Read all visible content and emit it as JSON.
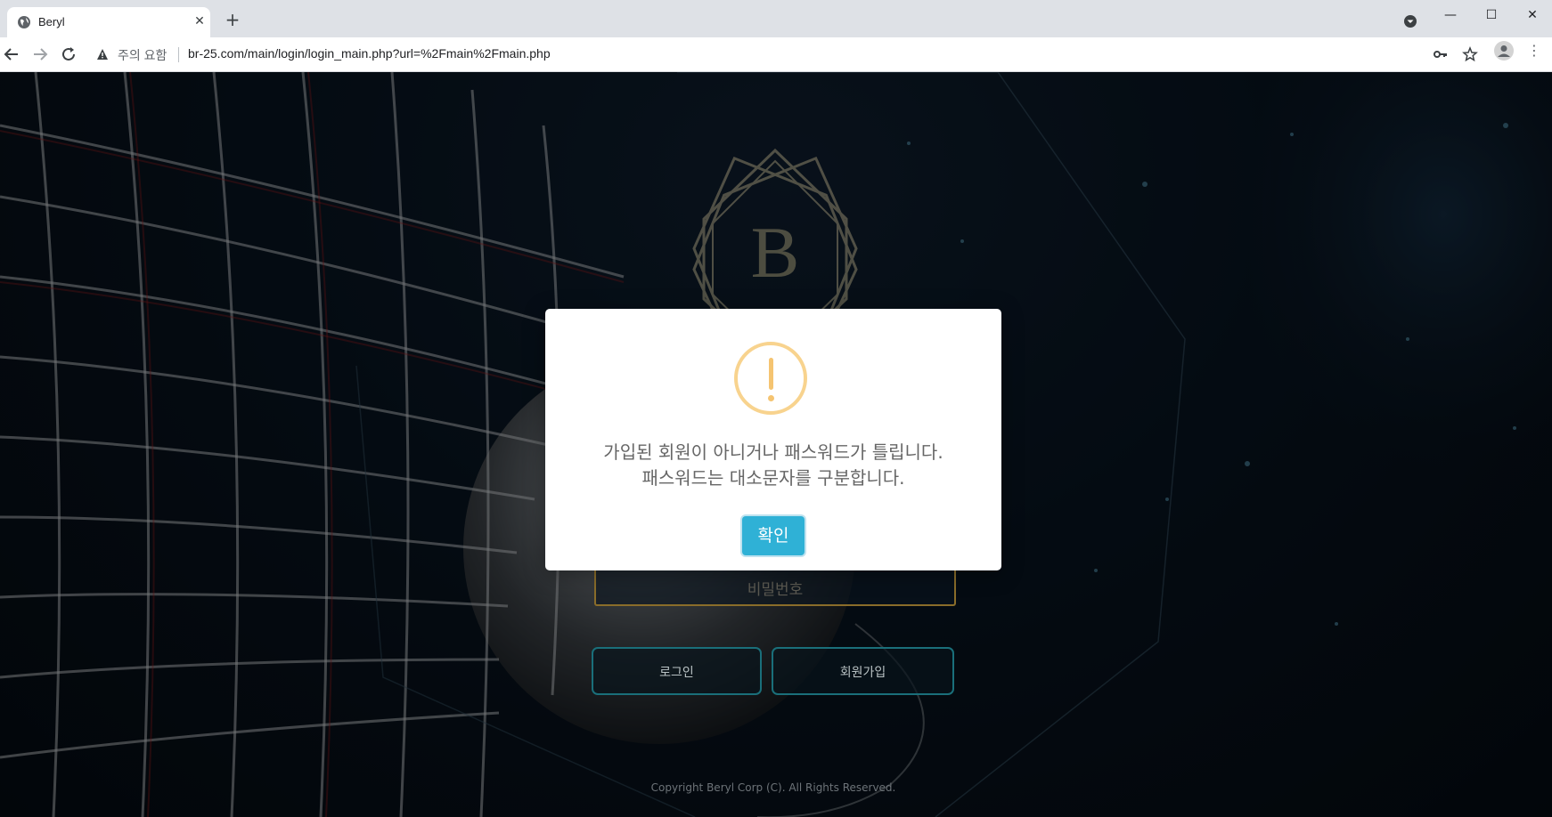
{
  "browser": {
    "tab_title": "Beryl",
    "tab_close": "✕",
    "new_tab": "+",
    "security_label": "주의 요함",
    "url": "br-25.com/main/login/login_main.php?url=%2Fmain%2Fmain.php",
    "window": {
      "minimize": "—",
      "maximize": "☐",
      "close": "✕"
    },
    "menu": "⋮"
  },
  "login": {
    "logo_letter": "B",
    "password_placeholder": "비밀번호",
    "login_button": "로그인",
    "signup_button": "회원가입",
    "copyright": "Copyright Beryl Corp (C). All Rights Reserved."
  },
  "alert": {
    "line1": "가입된 회원이 아니거나 패스워드가 틀립니다.",
    "line2": "패스워드는 대소문자를 구분합니다.",
    "confirm": "확인"
  },
  "colors": {
    "accent_button": "#2fb1d6",
    "warning_icon": "#f8d38e",
    "field_border": "#8a6d2a",
    "button_border": "#1a6f7a"
  },
  "icons": [
    "globe-icon",
    "back-icon",
    "forward-icon",
    "reload-icon",
    "warning-icon",
    "key-icon",
    "star-icon",
    "profile-icon",
    "tab-search-icon"
  ]
}
